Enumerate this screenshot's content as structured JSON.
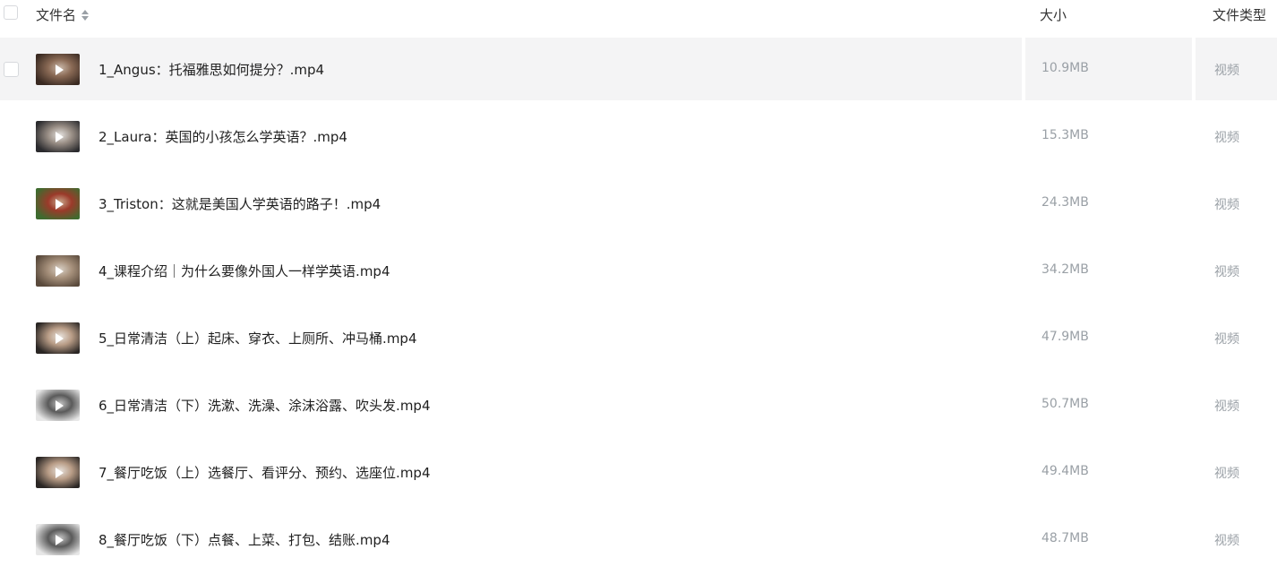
{
  "header": {
    "name_label": "文件名",
    "size_label": "大小",
    "type_label": "文件类型"
  },
  "files": [
    {
      "name": "1_Angus：托福雅思如何提分？.mp4",
      "size": "10.9MB",
      "type": "视频",
      "thumb_colors": [
        "#3a2a22",
        "#8a6a55",
        "#c9b7a8"
      ]
    },
    {
      "name": "2_Laura：英国的小孩怎么学英语？.mp4",
      "size": "15.3MB",
      "type": "视频",
      "thumb_colors": [
        "#2b2b2e",
        "#9a8f86",
        "#e4e1de"
      ]
    },
    {
      "name": "3_Triston：这就是美国人学英语的路子！.mp4",
      "size": "24.3MB",
      "type": "视频",
      "thumb_colors": [
        "#3f6b2f",
        "#9b3a2a",
        "#c9a88c"
      ]
    },
    {
      "name": "4_课程介绍｜为什么要像外国人一样学英语.mp4",
      "size": "34.2MB",
      "type": "视频",
      "thumb_colors": [
        "#5a4a3c",
        "#a7917c",
        "#d8cfc4"
      ]
    },
    {
      "name": "5_日常清洁（上）起床、穿衣、上厕所、冲马桶.mp4",
      "size": "47.9MB",
      "type": "视频",
      "thumb_colors": [
        "#2a2624",
        "#b89c86",
        "#e8e2dc"
      ]
    },
    {
      "name": "6_日常清洁（下）洗漱、洗澡、涂沫浴露、吹头发.mp4",
      "size": "50.7MB",
      "type": "视频",
      "thumb_colors": [
        "#e7e7e7",
        "#5a5a5a",
        "#c4c4c4"
      ]
    },
    {
      "name": "7_餐厅吃饭（上）选餐厅、看评分、预约、选座位.mp4",
      "size": "49.4MB",
      "type": "视频",
      "thumb_colors": [
        "#2a2624",
        "#b89c86",
        "#e8e2dc"
      ]
    },
    {
      "name": "8_餐厅吃饭（下）点餐、上菜、打包、结账.mp4",
      "size": "48.7MB",
      "type": "视频",
      "thumb_colors": [
        "#e7e7e7",
        "#5a5a5a",
        "#c4c4c4"
      ]
    }
  ]
}
